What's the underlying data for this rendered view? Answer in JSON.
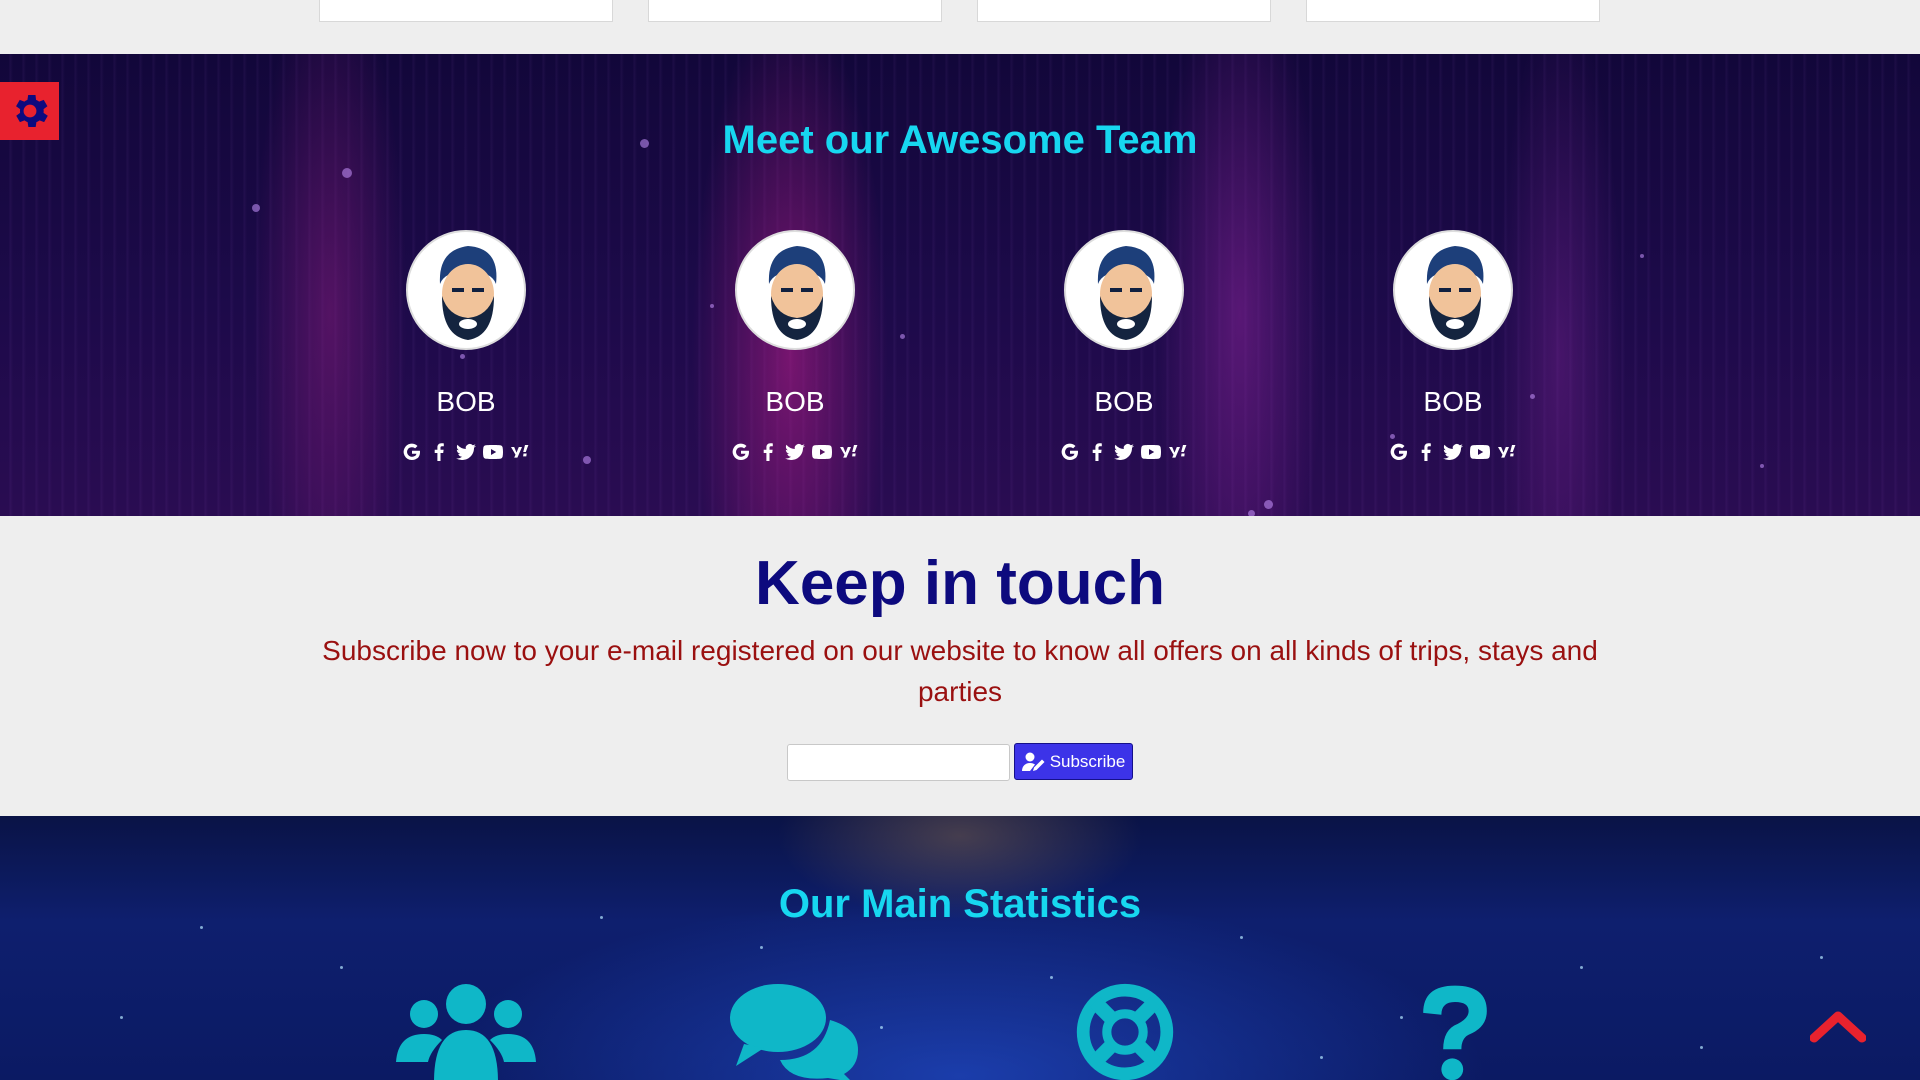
{
  "team": {
    "title": "Meet our Awesome Team",
    "members": [
      {
        "name": "BOB",
        "socials": [
          "google-icon",
          "facebook-icon",
          "twitter-icon",
          "youtube-icon",
          "yahoo-icon"
        ]
      },
      {
        "name": "BOB",
        "socials": [
          "google-icon",
          "facebook-icon",
          "twitter-icon",
          "youtube-icon",
          "yahoo-icon"
        ]
      },
      {
        "name": "BOB",
        "socials": [
          "google-icon",
          "facebook-icon",
          "twitter-icon",
          "youtube-icon",
          "yahoo-icon"
        ]
      },
      {
        "name": "BOB",
        "socials": [
          "google-icon",
          "facebook-icon",
          "twitter-icon",
          "youtube-icon",
          "yahoo-icon"
        ]
      }
    ]
  },
  "newsletter": {
    "title": "Keep in touch",
    "text": "Subscribe now to your e-mail registered on our website to know all offers on all kinds of trips, stays and parties",
    "input_value": "",
    "button_label": "Subscribe"
  },
  "stats": {
    "title": "Our Main Statistics",
    "icons": [
      "users-icon",
      "comments-icon",
      "life-ring-icon",
      "question-icon"
    ]
  },
  "colors": {
    "accent_cyan": "#17d7f0",
    "heading_navy": "#0d0a7e",
    "text_red": "#9a1010",
    "button_blue": "#3c33e8",
    "gear_red": "#e8222e",
    "icon_teal": "#0fb7c8"
  }
}
